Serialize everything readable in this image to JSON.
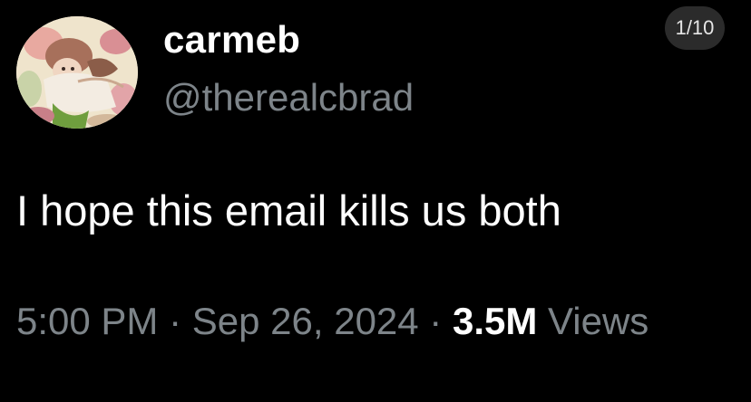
{
  "profile": {
    "display_name": "carmeb",
    "handle": "@therealcbrad",
    "avatar_icon": "avatar-illustration"
  },
  "page_counter": "1/10",
  "tweet": {
    "text": "I hope this email kills us both"
  },
  "meta": {
    "time": "5:00 PM",
    "separator": " · ",
    "date": "Sep 26, 2024",
    "views_count": "3.5M",
    "views_label": " Views"
  },
  "colors": {
    "background": "#000000",
    "primary_text": "#ffffff",
    "secondary_text": "#7d8489",
    "counter_pill": "#2b2b2b"
  }
}
